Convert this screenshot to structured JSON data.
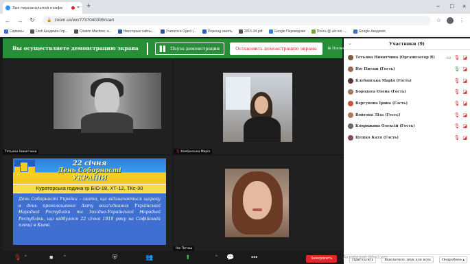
{
  "browser": {
    "tab_title": "Зал персональной конфе",
    "tab_close": "×",
    "new_tab": "+",
    "window_controls": [
      "−",
      "□",
      "×"
    ],
    "url": "zoom.us/wc/7737040395/start",
    "bookmarks": [
      {
        "label": "Сервисы",
        "color": "#3b6fd6"
      },
      {
        "label": "Fivdi Академія-Гор...",
        "color": "#555555"
      },
      {
        "label": "Citation Machine, a...",
        "color": "#555555"
      },
      {
        "label": "Некоторые сайты...",
        "color": "#3056a8"
      },
      {
        "label": "Учитися в Одесі |...",
        "color": "#3056a8"
      },
      {
        "label": "Розклад занять",
        "color": "#2c5db8"
      },
      {
        "label": "2015-34.pdf",
        "color": "#555555"
      },
      {
        "label": "Google Переводчик",
        "color": "#3b7fe0"
      },
      {
        "label": "Почта @ ukr.net -...",
        "color": "#7aa83a"
      },
      {
        "label": "Google Академія",
        "color": "#3b6fd6"
      }
    ]
  },
  "sharing_bar": {
    "status_text": "Вы осуществляете демонстрацию экрана",
    "pause_label": "Пауза демонстрации",
    "stop_label": "Остановить демонстрацию экрана",
    "more_label": "Посмотреть"
  },
  "videos": {
    "tile1_name": "Тетьяна Никитчина",
    "tile2_name": "Клебанська Марія",
    "tile4_name": "Ню Питаш"
  },
  "slide": {
    "date": "22 січня",
    "title_line1": "День Соборності",
    "title_line2": "УКРАЇНИ",
    "subtitle": "Кураторська година гр БІО-18, ХТ-12, ТКс-30",
    "body": "День Соборності України – свято, що відзначається щороку в день проголошення Акту возз'єднання Української Народної Республіки та Західно-Української Народної Республіки, що відбулося 22 січня 1919 року на Софійській площі в Києві."
  },
  "participants": {
    "title": "Участники (9)",
    "list": [
      {
        "name": "Тетьяна Никитчина (Организатор Я)",
        "avatar_color": "#7a5c48",
        "video_on": true,
        "mic": "muted"
      },
      {
        "name": "Ню Питаш (Гость)",
        "avatar_color": "#9a6a52",
        "video_on": false,
        "mic": "on"
      },
      {
        "name": "Клебанська Марія (Гость)",
        "avatar_color": "#5a3a32",
        "video_on": false,
        "mic": "muted"
      },
      {
        "name": "Бородата Олена (Гость)",
        "avatar_color": "#a07a62",
        "video_on": false,
        "mic": "muted"
      },
      {
        "name": "Вергунова Ірина (Гость)",
        "avatar_color": "#c05a3a",
        "video_on": false,
        "mic": "muted"
      },
      {
        "name": "Войтова Ліза (Гость)",
        "avatar_color": "#b07858",
        "video_on": false,
        "mic": "muted"
      },
      {
        "name": "Коврижних Олексій (Гость)",
        "avatar_color": "#6a6a6a",
        "video_on": false,
        "mic": "muted"
      },
      {
        "name": "Цушко Катя (Гость)",
        "avatar_color": "#8a4a5a",
        "video_on": false,
        "mic": "muted"
      }
    ],
    "footer": {
      "invite": "Пригласить",
      "mute_all": "Выключить звук для всех",
      "more": "Подробнее ▴"
    }
  },
  "toolbar": {
    "end_label": "Завершить",
    "more_dots": "•••"
  },
  "os": {
    "watermark": "Активация Windows"
  }
}
